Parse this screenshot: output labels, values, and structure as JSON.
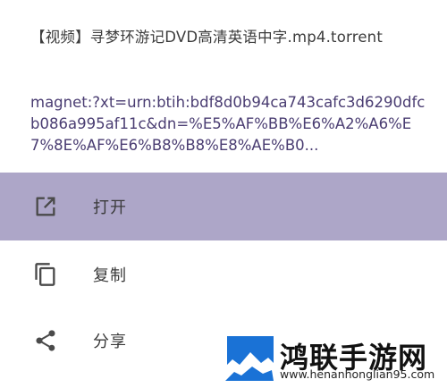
{
  "header": {
    "file_name": "【视频】寻梦环游记DVD高清英语中字.mp4.torrent",
    "magnet_link": "magnet:?xt=urn:btih:bdf8d0b94ca743cafc3d6290dfcb086a995af11c&dn=%E5%AF%BB%E6%A2%A6%E7%8E%AF%E6%B8%B8%E8%AE%B0..."
  },
  "menu": {
    "items": [
      {
        "label": "打开",
        "icon": "open-external-icon",
        "highlighted": true
      },
      {
        "label": "复制",
        "icon": "copy-icon",
        "highlighted": false
      },
      {
        "label": "分享",
        "icon": "share-icon",
        "highlighted": false
      }
    ]
  },
  "colors": {
    "highlight": "#ada6c8",
    "link_text": "#4a3d72",
    "icon": "#4a4a4a",
    "watermark_blue": "#1a72d6"
  },
  "watermark": {
    "name": "鸿联手游网",
    "url": "www.henanhonglian95.com"
  }
}
